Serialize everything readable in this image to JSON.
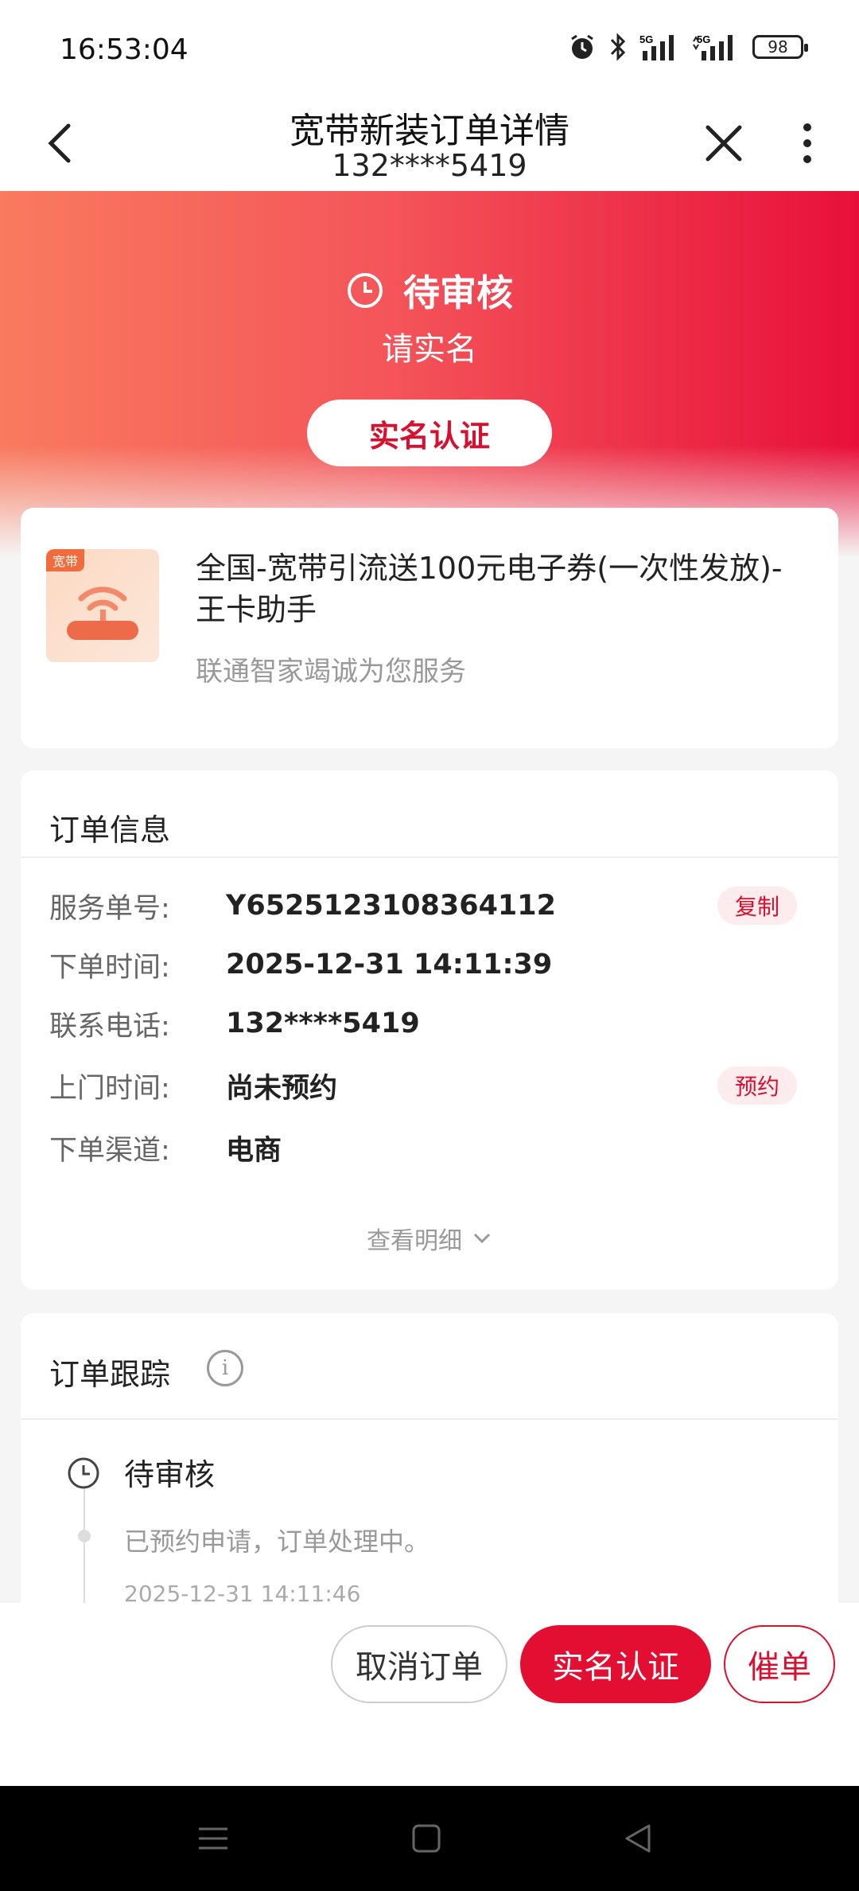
{
  "status_bar": {
    "time": "16:53:04",
    "battery": "98",
    "icons": [
      "alarm-icon",
      "bluetooth-icon",
      "5g-signal-icon",
      "5g-signal-icon"
    ]
  },
  "nav": {
    "title": "宽带新装订单详情",
    "subtitle": "132****5419"
  },
  "hero": {
    "status": "待审核",
    "sub": "请实名",
    "button": "实名认证"
  },
  "product": {
    "tag": "宽带",
    "title": "全国-宽带引流送100元电子券(一次性发放)-王卡助手",
    "subtitle": "联通智家竭诚为您服务"
  },
  "order_info": {
    "title": "订单信息",
    "rows": [
      {
        "label": "服务单号:",
        "value": "Y6525123108364112",
        "action": "复制"
      },
      {
        "label": "下单时间:",
        "value": "2025-12-31 14:11:39"
      },
      {
        "label": "联系电话:",
        "value": "132****5419"
      },
      {
        "label": "上门时间:",
        "value": "尚未预约",
        "action": "预约"
      },
      {
        "label": "下单渠道:",
        "value": "电商"
      }
    ],
    "detail_link": "查看明细"
  },
  "tracking": {
    "title": "订单跟踪",
    "items": [
      {
        "status": "待审核",
        "desc": "已预约申请，订单处理中。",
        "time": "2025-12-31 14:11:46"
      }
    ]
  },
  "actions": {
    "cancel": "取消订单",
    "verify": "实名认证",
    "urge": "催单"
  },
  "colors": {
    "brand_red": "#e30f33",
    "hero_gradient_start": "#f97a5e",
    "hero_gradient_end": "#e8103a"
  }
}
